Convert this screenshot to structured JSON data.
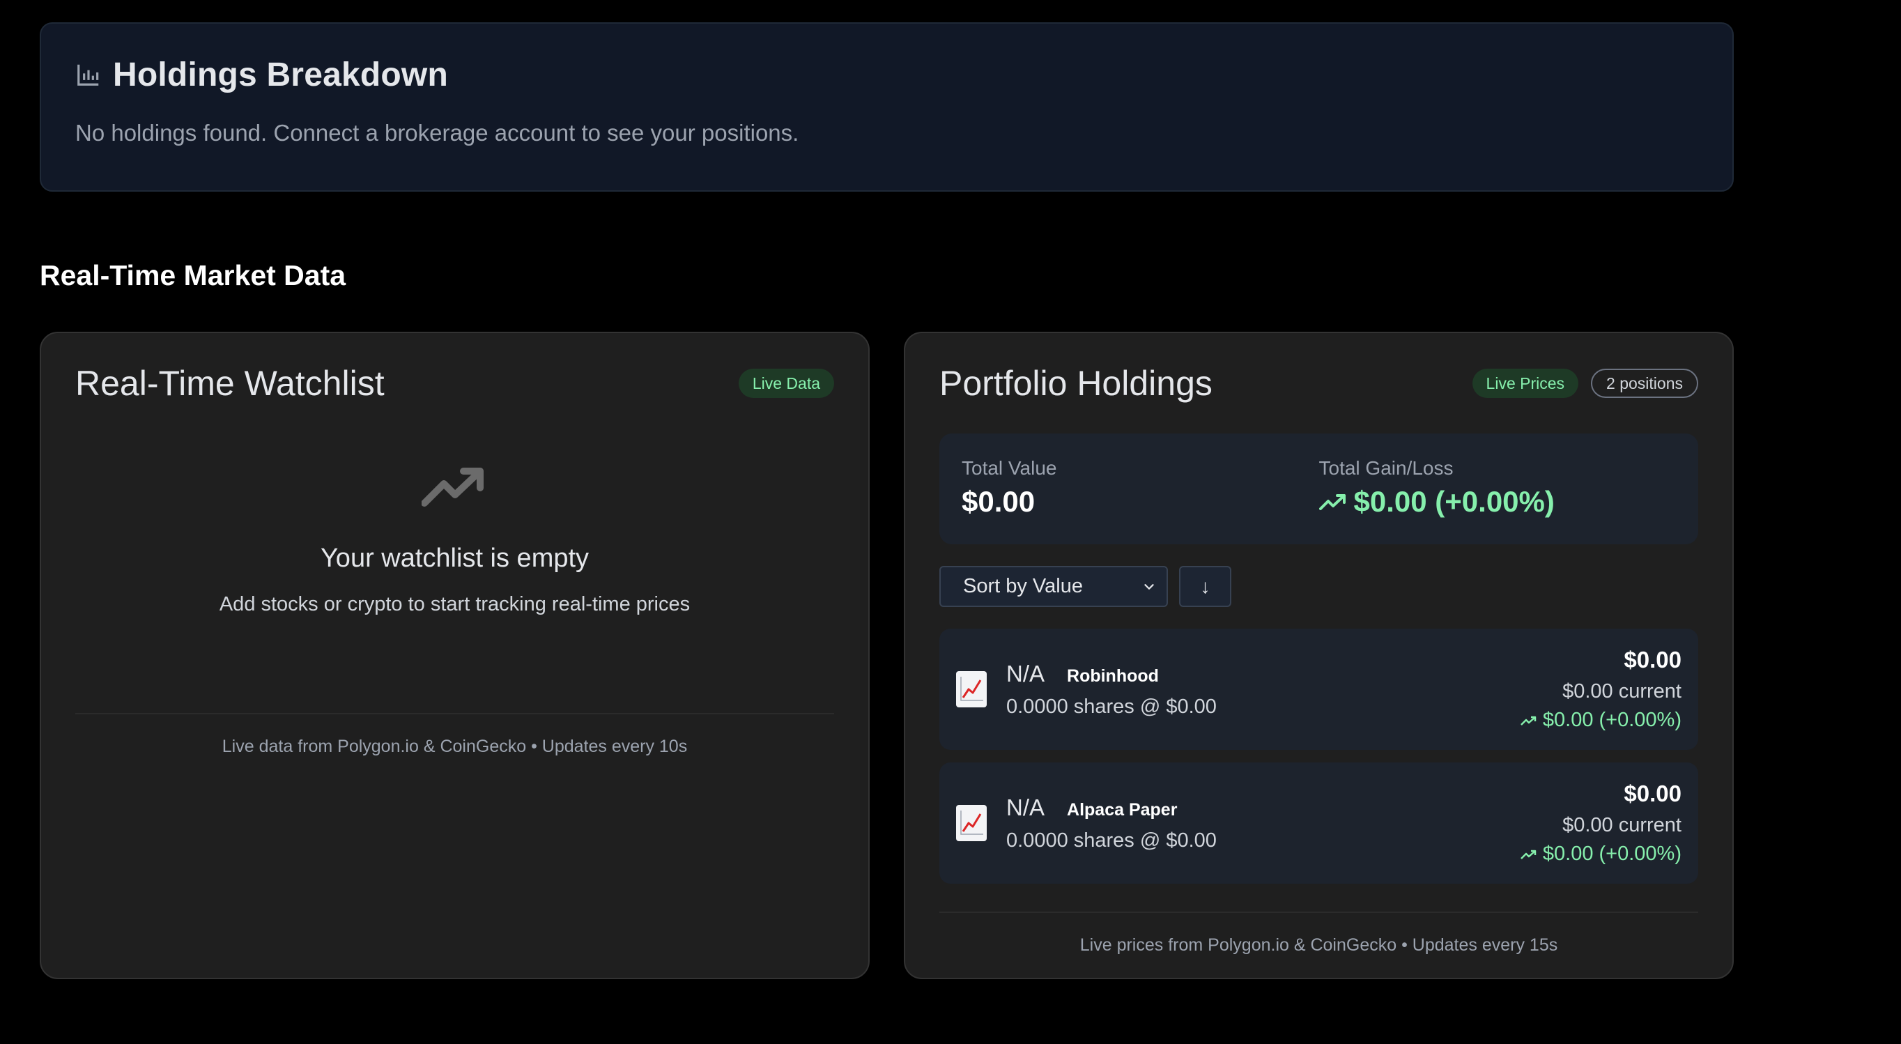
{
  "breakdown": {
    "title": "Holdings Breakdown",
    "message": "No holdings found. Connect a brokerage account to see your positions."
  },
  "section": {
    "title": "Real-Time Market Data"
  },
  "watchlist": {
    "title": "Real-Time Watchlist",
    "badge": "Live Data",
    "empty_title": "Your watchlist is empty",
    "empty_subtitle": "Add stocks or crypto to start tracking real-time prices",
    "footer": "Live data from Polygon.io & CoinGecko • Updates every 10s"
  },
  "portfolio": {
    "title": "Portfolio Holdings",
    "badge_live": "Live Prices",
    "badge_count": "2 positions",
    "total_value_label": "Total Value",
    "total_value": "$0.00",
    "total_gain_label": "Total Gain/Loss",
    "total_gain": "$0.00 (+0.00%)",
    "sort_label": "Sort by Value",
    "sort_direction": "↓",
    "holdings": [
      {
        "ticker": "N/A",
        "broker": "Robinhood",
        "shares": "0.0000 shares @ $0.00",
        "value": "$0.00",
        "current": "$0.00 current",
        "change": "$0.00 (+0.00%)"
      },
      {
        "ticker": "N/A",
        "broker": "Alpaca Paper",
        "shares": "0.0000 shares @ $0.00",
        "value": "$0.00",
        "current": "$0.00 current",
        "change": "$0.00 (+0.00%)"
      }
    ],
    "footer": "Live prices from Polygon.io & CoinGecko • Updates every 15s"
  },
  "colors": {
    "background": "#000000",
    "card": "#111827",
    "panel": "#1f1f1f",
    "positive": "#86efac"
  },
  "icons": {
    "breakdown": "bar-chart-icon",
    "trend": "trending-up-icon",
    "holding": "chart-increasing-icon",
    "select": "chevron-down-icon",
    "sort": "arrow-down-icon"
  }
}
